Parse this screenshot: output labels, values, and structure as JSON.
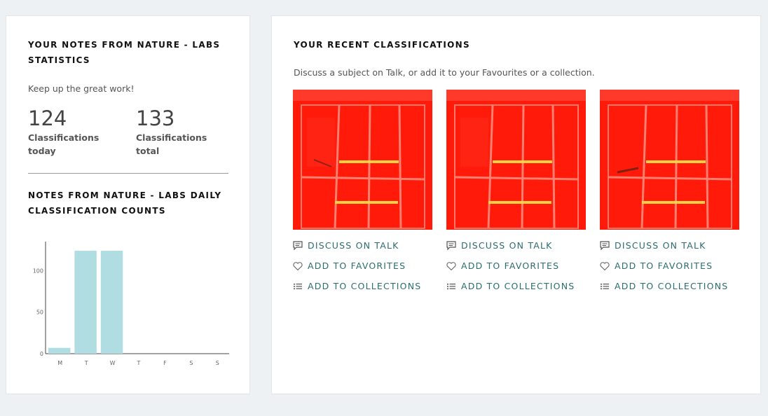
{
  "stats": {
    "title": "YOUR NOTES FROM NATURE - LABS STATISTICS",
    "message": "Keep up the great work!",
    "today": {
      "value": "124",
      "label": "Classifications today"
    },
    "total": {
      "value": "133",
      "label": "Classifications total"
    }
  },
  "daily": {
    "title": "NOTES FROM NATURE - LABS DAILY CLASSIFICATION COUNTS"
  },
  "chart_data": {
    "type": "bar",
    "categories": [
      "M",
      "T",
      "W",
      "T",
      "F",
      "S",
      "S"
    ],
    "values": [
      7,
      124,
      124,
      0,
      0,
      0,
      0
    ],
    "yticks": [
      "0",
      "50",
      "100"
    ],
    "ylim": [
      0,
      135
    ],
    "bar_color": "#b0dde1"
  },
  "recent": {
    "title": "YOUR RECENT CLASSIFICATIONS",
    "subtitle": "Discuss a subject on Talk, or add it to your Favourites or a collection.",
    "actions": {
      "discuss": "DISCUSS ON TALK",
      "favorite": "ADD TO FAVORITES",
      "collect": "ADD TO COLLECTIONS"
    },
    "icons": [
      "speech-bubble-icon",
      "heart-icon",
      "list-icon"
    ],
    "accent_color": "#2b6d71"
  }
}
